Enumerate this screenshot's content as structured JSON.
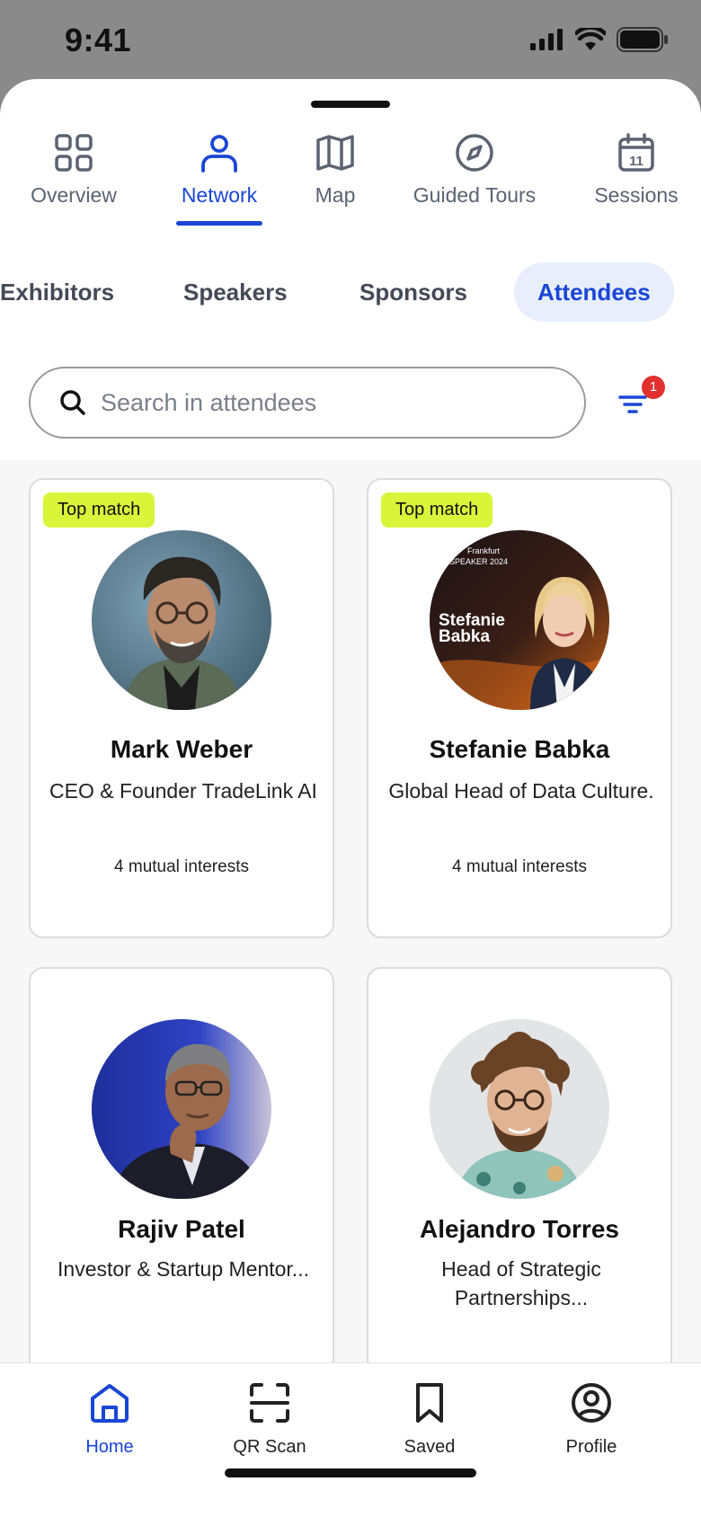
{
  "status_bar": {
    "time": "9:41"
  },
  "top_nav": [
    {
      "label": "Overview",
      "icon": "grid-icon",
      "active": false
    },
    {
      "label": "Network",
      "icon": "person-icon",
      "active": true
    },
    {
      "label": "Map",
      "icon": "map-icon",
      "active": false
    },
    {
      "label": "Guided Tours",
      "icon": "compass-icon",
      "active": false
    },
    {
      "label": "Sessions",
      "icon": "calendar-icon",
      "active": false
    }
  ],
  "categories": [
    {
      "label": "Exhibitors",
      "active": false
    },
    {
      "label": "Speakers",
      "active": false
    },
    {
      "label": "Sponsors",
      "active": false
    },
    {
      "label": "Attendees",
      "active": true
    }
  ],
  "search": {
    "placeholder": "Search in attendees",
    "value": ""
  },
  "filter": {
    "badge_count": "1"
  },
  "attendees": [
    {
      "badge": "Top match",
      "name": "Mark Weber",
      "role": "CEO & Founder TradeLink AI",
      "mutual": "4 mutual interests"
    },
    {
      "badge": "Top match",
      "name": "Stefanie Babka",
      "role": "Global Head of Data Culture.",
      "mutual": "4 mutual interests",
      "avatar_text": {
        "line1": "Stefanie",
        "line2": "Babka",
        "top1": "Frankfurt",
        "top2": "SPEAKER 2024"
      }
    },
    {
      "badge": "",
      "name": "Rajiv Patel",
      "role": "Investor & Startup Mentor...",
      "mutual": ""
    },
    {
      "badge": "",
      "name": "Alejandro Torres",
      "role": "Head of Strategic Partnerships...",
      "mutual": ""
    }
  ],
  "bottom_nav": [
    {
      "label": "Home",
      "icon": "home-icon",
      "active": true
    },
    {
      "label": "QR Scan",
      "icon": "qr-scan-icon",
      "active": false
    },
    {
      "label": "Saved",
      "icon": "bookmark-icon",
      "active": false
    },
    {
      "label": "Profile",
      "icon": "profile-icon",
      "active": false
    }
  ],
  "colors": {
    "accent": "#1a46d6",
    "badge": "#d8f53a",
    "alert": "#e0312e"
  }
}
